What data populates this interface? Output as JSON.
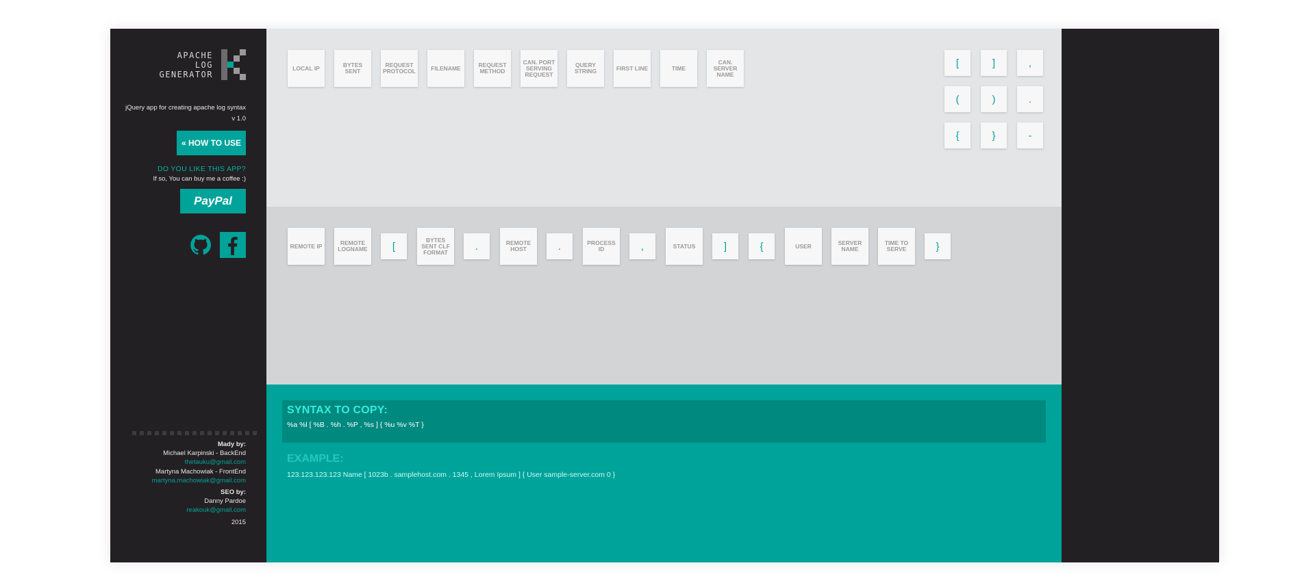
{
  "app": {
    "logo_lines": [
      "APACHE",
      "LOG",
      "GENERATOR"
    ],
    "description": "jQuery app for creating apache log syntax",
    "version": "v 1.0",
    "how_to_label": "« HOW TO USE",
    "like_question": "DO YOU LIKE THIS APP?",
    "like_sub": "If so, You can buy me a coffee :)",
    "paypal_label": "PayPal",
    "accent_color": "#00a39a",
    "dark_color": "#232023"
  },
  "credits": {
    "made_by": "Mady by:",
    "author1": "Michael Karpinski - BackEnd",
    "email1": "thetauku@gmail.com",
    "author2": "Martyna Machowiak - FrontEnd",
    "email2": "martyna.machowiak@gmail.com",
    "seo_by": "SEO by:",
    "author3": "Danny Pardoe",
    "email3": "reakouk@gmail.com",
    "year": "2015"
  },
  "available_tiles": [
    {
      "label": "LOCAL IP",
      "kind": "field"
    },
    {
      "label": "BYTES SENT",
      "kind": "field"
    },
    {
      "label": "REQUEST PROTOCOL",
      "kind": "field"
    },
    {
      "label": "FILENAME",
      "kind": "field"
    },
    {
      "label": "REQUEST METHOD",
      "kind": "field"
    },
    {
      "label": "CAN. PORT SERVING REQUEST",
      "kind": "field"
    },
    {
      "label": "QUERY STRING",
      "kind": "field"
    },
    {
      "label": "FIRST LINE",
      "kind": "field"
    },
    {
      "label": "TIME",
      "kind": "field"
    },
    {
      "label": "CAN. SERVER NAME",
      "kind": "field"
    }
  ],
  "symbol_tiles": [
    "[",
    "]",
    ",",
    "(",
    ")",
    ".",
    "{",
    "}",
    "-"
  ],
  "selected_tiles": [
    {
      "label": "REMOTE IP",
      "kind": "field"
    },
    {
      "label": "REMOTE LOGNAME",
      "kind": "field"
    },
    {
      "label": "[",
      "kind": "symbol"
    },
    {
      "label": "BYTES SENT CLF FORMAT",
      "kind": "field"
    },
    {
      "label": ".",
      "kind": "symbol"
    },
    {
      "label": "REMOTE HOST",
      "kind": "field"
    },
    {
      "label": ".",
      "kind": "symbol"
    },
    {
      "label": "PROCESS ID",
      "kind": "field"
    },
    {
      "label": ",",
      "kind": "symbol"
    },
    {
      "label": "STATUS",
      "kind": "field"
    },
    {
      "label": "]",
      "kind": "symbol"
    },
    {
      "label": "{",
      "kind": "symbol"
    },
    {
      "label": "USER",
      "kind": "field"
    },
    {
      "label": "SERVER NAME",
      "kind": "field"
    },
    {
      "label": "TIME TO SERVE",
      "kind": "field"
    },
    {
      "label": "}",
      "kind": "symbol"
    }
  ],
  "output": {
    "syntax_title": "SYNTAX TO COPY:",
    "syntax_value": "%a %l [ %B . %h . %P , %s ] { %u %v %T }",
    "example_title": "EXAMPLE:",
    "example_value": "123.123.123.123 Name [ 1023b . samplehost.com . 1345 , Lorem Ipsum ] { User sample-server.com 0 }"
  }
}
